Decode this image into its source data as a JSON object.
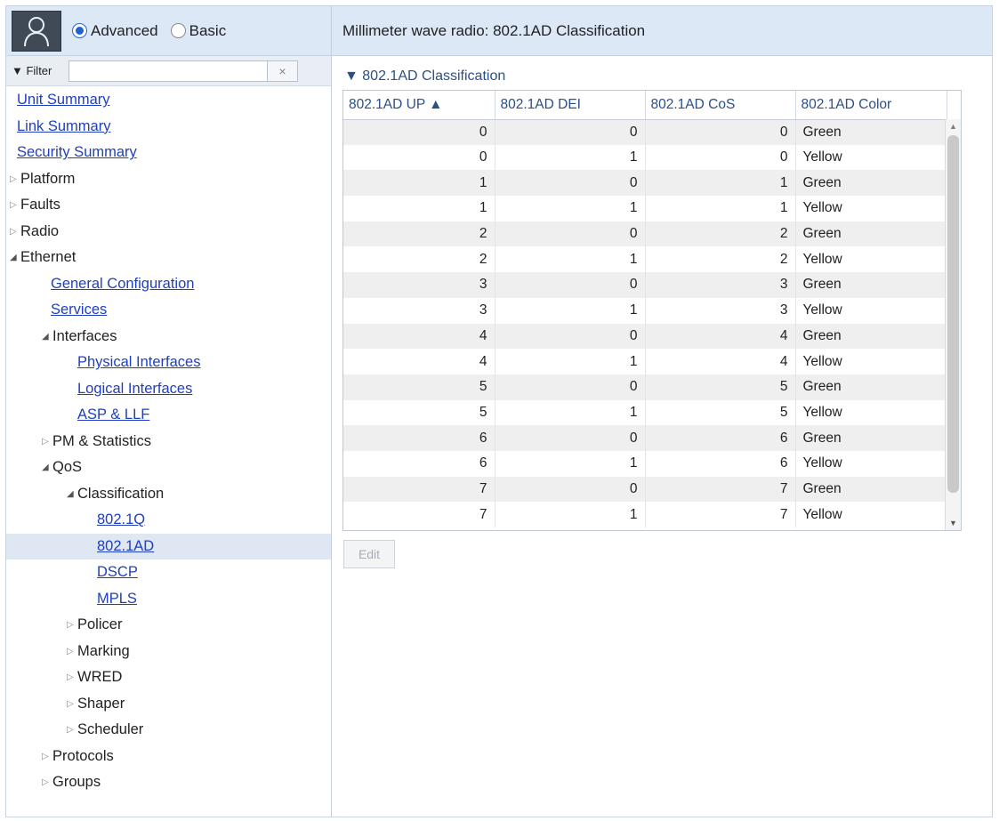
{
  "mode": {
    "advanced_label": "Advanced",
    "basic_label": "Basic",
    "selected": "Advanced"
  },
  "filter": {
    "label": "▼ Filter",
    "value": "",
    "clear_glyph": "×"
  },
  "tree": [
    {
      "label": "Unit Summary",
      "type": "link",
      "level": 0
    },
    {
      "label": "Link Summary",
      "type": "link",
      "level": 0
    },
    {
      "label": "Security Summary",
      "type": "link",
      "level": 0
    },
    {
      "label": "Platform",
      "type": "folder",
      "expanded": false,
      "level": 0
    },
    {
      "label": "Faults",
      "type": "folder",
      "expanded": false,
      "level": 0
    },
    {
      "label": "Radio",
      "type": "folder",
      "expanded": false,
      "level": 0
    },
    {
      "label": "Ethernet",
      "type": "folder",
      "expanded": true,
      "level": 0
    },
    {
      "label": "General Configuration",
      "type": "link",
      "level": 1
    },
    {
      "label": "Services",
      "type": "link",
      "level": 1
    },
    {
      "label": "Interfaces",
      "type": "folder",
      "expanded": true,
      "level": 1
    },
    {
      "label": "Physical Interfaces",
      "type": "link",
      "level": 2
    },
    {
      "label": "Logical Interfaces",
      "type": "link",
      "level": 2
    },
    {
      "label": "ASP & LLF",
      "type": "link",
      "level": 2
    },
    {
      "label": "PM & Statistics",
      "type": "folder",
      "expanded": false,
      "level": 1
    },
    {
      "label": "QoS",
      "type": "folder",
      "expanded": true,
      "level": 1
    },
    {
      "label": "Classification",
      "type": "folder",
      "expanded": true,
      "level": 2
    },
    {
      "label": "802.1Q",
      "type": "link",
      "level": 3
    },
    {
      "label": "802.1AD",
      "type": "link",
      "level": 3,
      "selected": true
    },
    {
      "label": "DSCP",
      "type": "link",
      "level": 3
    },
    {
      "label": "MPLS",
      "type": "link",
      "level": 3
    },
    {
      "label": "Policer",
      "type": "folder",
      "expanded": false,
      "level": 2
    },
    {
      "label": "Marking",
      "type": "folder",
      "expanded": false,
      "level": 2
    },
    {
      "label": "WRED",
      "type": "folder",
      "expanded": false,
      "level": 2
    },
    {
      "label": "Shaper",
      "type": "folder",
      "expanded": false,
      "level": 2
    },
    {
      "label": "Scheduler",
      "type": "folder",
      "expanded": false,
      "level": 2
    },
    {
      "label": "Protocols",
      "type": "folder",
      "expanded": false,
      "level": 1
    },
    {
      "label": "Groups",
      "type": "folder",
      "expanded": false,
      "level": 1
    }
  ],
  "main": {
    "title": "Millimeter wave radio: 802.1AD Classification",
    "section_title": "▼ 802.1AD Classification",
    "columns": [
      "802.1AD UP ▲",
      "802.1AD DEI",
      "802.1AD CoS",
      "802.1AD Color"
    ],
    "rows": [
      [
        "0",
        "0",
        "0",
        "Green"
      ],
      [
        "0",
        "1",
        "0",
        "Yellow"
      ],
      [
        "1",
        "0",
        "1",
        "Green"
      ],
      [
        "1",
        "1",
        "1",
        "Yellow"
      ],
      [
        "2",
        "0",
        "2",
        "Green"
      ],
      [
        "2",
        "1",
        "2",
        "Yellow"
      ],
      [
        "3",
        "0",
        "3",
        "Green"
      ],
      [
        "3",
        "1",
        "3",
        "Yellow"
      ],
      [
        "4",
        "0",
        "4",
        "Green"
      ],
      [
        "4",
        "1",
        "4",
        "Yellow"
      ],
      [
        "5",
        "0",
        "5",
        "Green"
      ],
      [
        "5",
        "1",
        "5",
        "Yellow"
      ],
      [
        "6",
        "0",
        "6",
        "Green"
      ],
      [
        "6",
        "1",
        "6",
        "Yellow"
      ],
      [
        "7",
        "0",
        "7",
        "Green"
      ],
      [
        "7",
        "1",
        "7",
        "Yellow"
      ]
    ],
    "edit_label": "Edit",
    "edit_enabled": false
  },
  "colors": {
    "header_bg": "#dce8f6",
    "link": "#1f3fbd",
    "selected_row": "#dfe7f3",
    "table_header_text": "#2c4f86"
  }
}
